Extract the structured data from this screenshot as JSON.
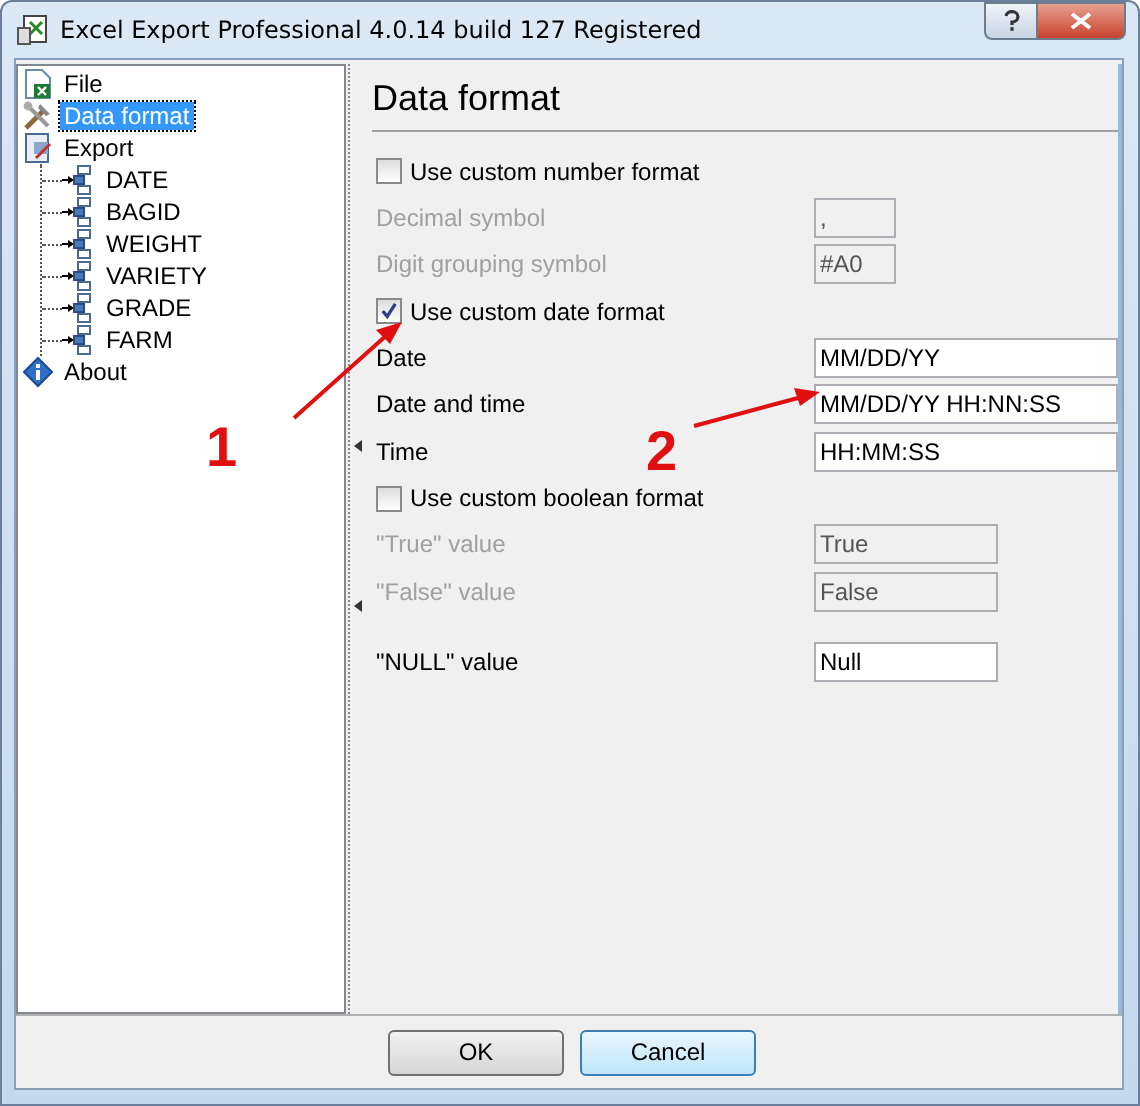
{
  "window": {
    "title": "Excel Export Professional 4.0.14 build 127 Registered"
  },
  "tree": [
    {
      "label": "File",
      "kind": "file",
      "selected": false
    },
    {
      "label": "Data format",
      "kind": "tools",
      "selected": true
    },
    {
      "label": "Export",
      "kind": "export",
      "selected": false,
      "expanded": true,
      "children": [
        {
          "label": "DATE",
          "kind": "field",
          "selected": false
        },
        {
          "label": "BAGID",
          "kind": "field",
          "selected": false
        },
        {
          "label": "WEIGHT",
          "kind": "field",
          "selected": false
        },
        {
          "label": "VARIETY",
          "kind": "field",
          "selected": false
        },
        {
          "label": "GRADE",
          "kind": "field",
          "selected": false
        },
        {
          "label": "FARM",
          "kind": "field",
          "selected": false
        }
      ]
    },
    {
      "label": "About",
      "kind": "info",
      "selected": false
    }
  ],
  "panel": {
    "title": "Data format"
  },
  "groups": [
    {
      "checkbox": {
        "label": "Use custom number format",
        "checked": false
      },
      "fields": [
        {
          "label": "Decimal symbol",
          "value": ",",
          "disabled": true
        },
        {
          "label": "Digit grouping symbol",
          "value": "#A0",
          "disabled": true
        }
      ]
    },
    {
      "checkbox": {
        "label": "Use custom date format",
        "checked": true
      },
      "fields": [
        {
          "label": "Date",
          "value": "MM/DD/YY",
          "disabled": false
        },
        {
          "label": "Date and time",
          "value": "MM/DD/YY HH:NN:SS",
          "disabled": false
        },
        {
          "label": "Time",
          "value": "HH:MM:SS",
          "disabled": false
        }
      ]
    },
    {
      "checkbox": {
        "label": "Use custom boolean format",
        "checked": false
      },
      "fields": [
        {
          "label": "\"True\" value",
          "value": "True",
          "disabled": true
        },
        {
          "label": "\"False\" value",
          "value": "False",
          "disabled": true
        }
      ]
    }
  ],
  "null_field": {
    "label": "\"NULL\" value",
    "value": "Null",
    "disabled": false
  },
  "buttons": [
    {
      "label": "OK",
      "default": false
    },
    {
      "label": "Cancel",
      "default": true
    }
  ],
  "annotations": [
    {
      "label": "1"
    },
    {
      "label": "2"
    }
  ]
}
